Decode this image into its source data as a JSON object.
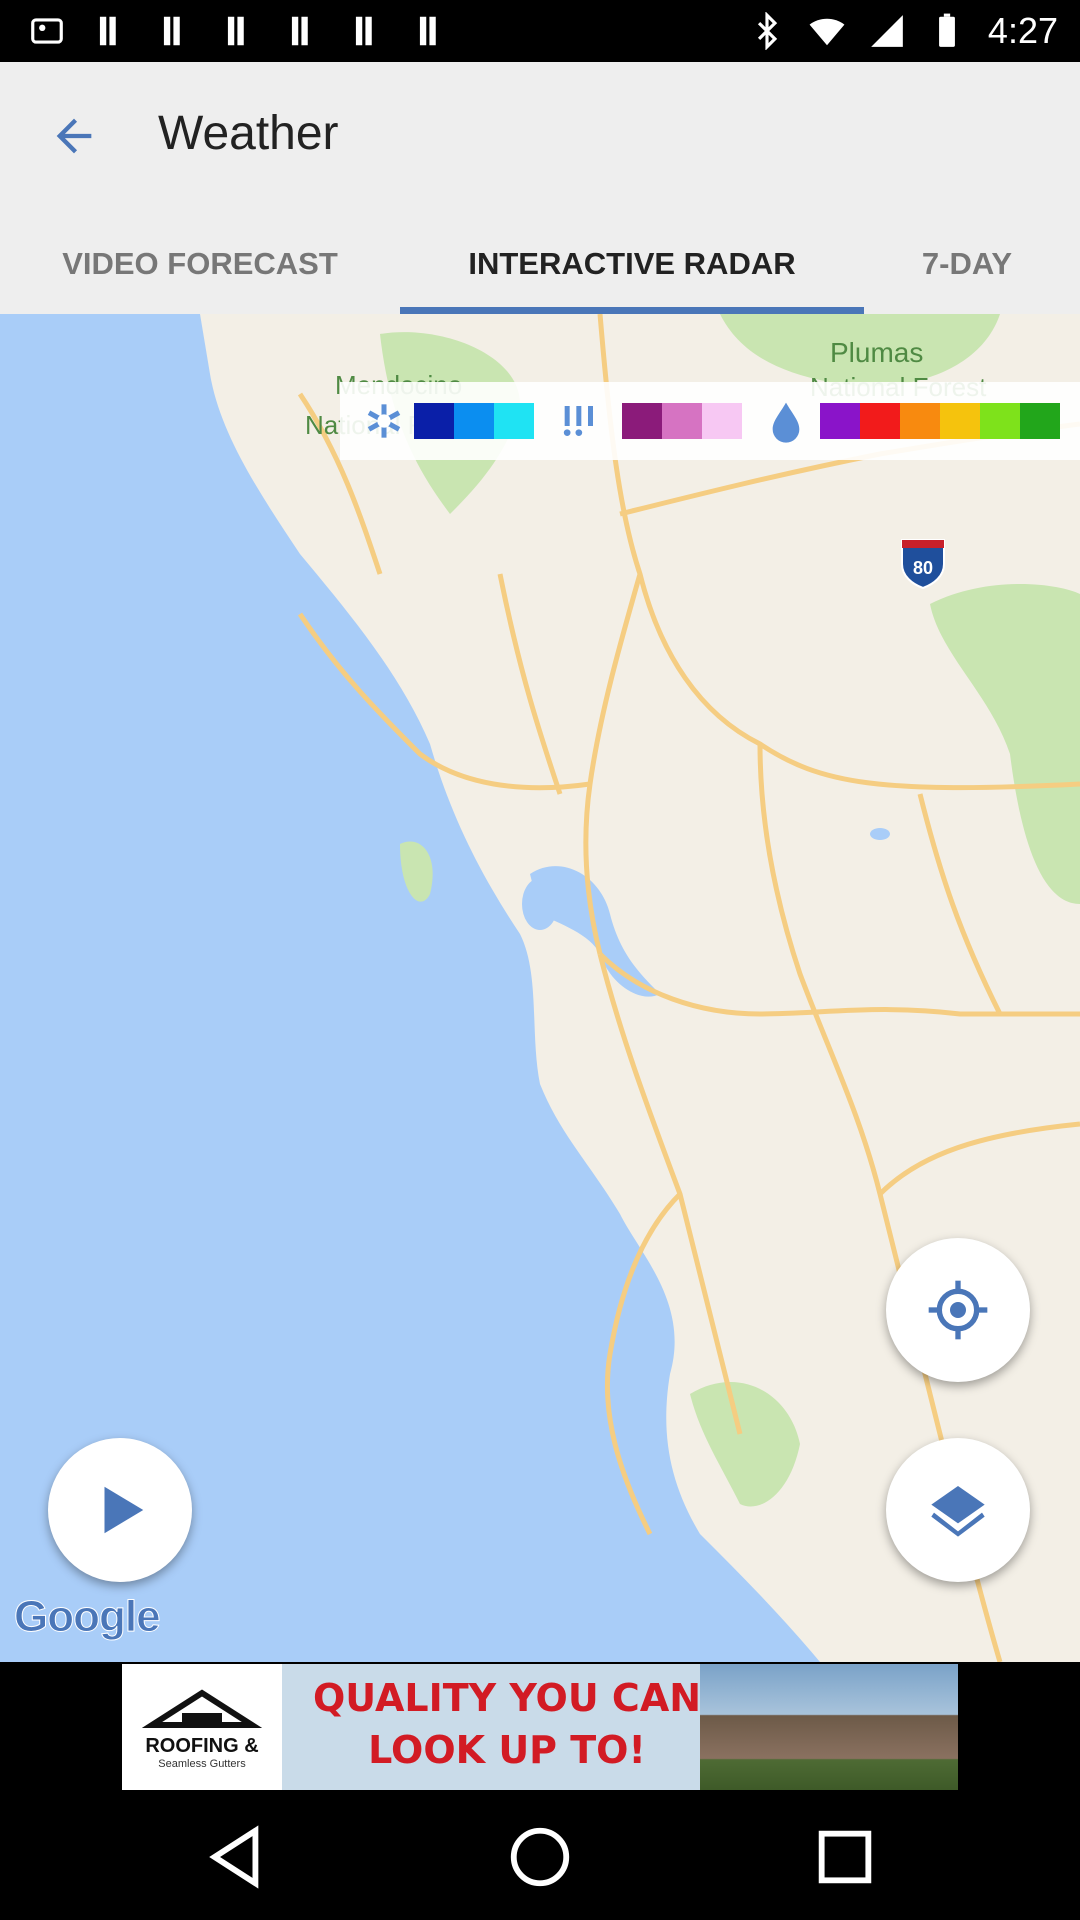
{
  "status": {
    "time": "4:27"
  },
  "header": {
    "title": "Weather"
  },
  "tabs": [
    {
      "label": "VIDEO FORECAST",
      "active": false
    },
    {
      "label": "INTERACTIVE RADAR",
      "active": true
    },
    {
      "label": "7-DAY",
      "active": false
    }
  ],
  "map": {
    "labels": {
      "forest_right": "Plumas",
      "forest_right_2": "National Forest",
      "forest_left": "Mendocino",
      "forest_left_2": "National Forest",
      "interstate": "80"
    },
    "attribution": "Google"
  },
  "legend": {
    "snow_colors": [
      "#0a1fa8",
      "#0b8ef0",
      "#1fe3f3"
    ],
    "mix_colors": [
      "#8b1b7a",
      "#d673c2",
      "#f7c8f3"
    ],
    "rain_colors": [
      "#8a14c9",
      "#f21b1b",
      "#f88a0f",
      "#f5c30d",
      "#7ee21b",
      "#22a61b"
    ]
  },
  "ad": {
    "brand": "ROOFING &",
    "brand_sub": "Seamless Gutters",
    "headline": "QUALITY YOU CAN LOOK UP TO!"
  },
  "colors": {
    "accent": "#4a76b8",
    "water": "#a9cdf8",
    "land": "#f3efe6",
    "park": "#c9e5b1",
    "road": "#f5cd82"
  }
}
